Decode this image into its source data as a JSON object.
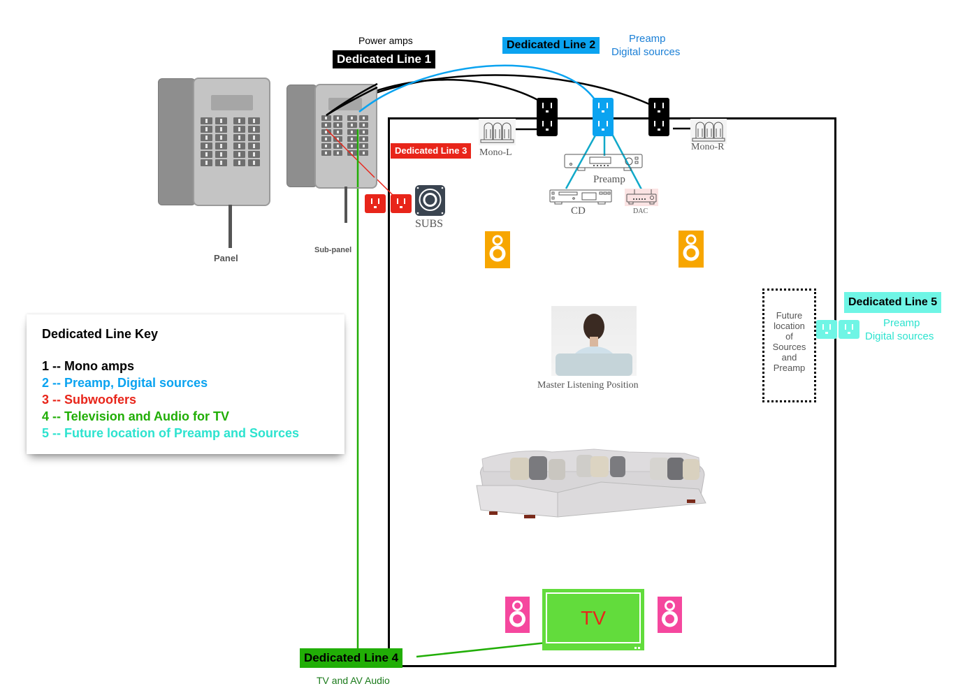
{
  "colors": {
    "line1": "#000000",
    "line2": "#0aa3f0",
    "line3": "#e8251a",
    "line4": "#21ae06",
    "line5": "#2de3cf",
    "line5_box": "#6ff5e5",
    "speaker_front": "#f7a600",
    "speaker_rear": "#f5479e",
    "tv": "#62dc3c"
  },
  "panels": {
    "main_label": "Panel",
    "sub_label": "Sub-panel"
  },
  "lines": {
    "line1": {
      "label": "Dedicated Line 1",
      "caption": "Power amps"
    },
    "line2": {
      "label": "Dedicated Line 2",
      "caption_1": "Preamp",
      "caption_2": "Digital sources"
    },
    "line3": {
      "label": "Dedicated Line 3"
    },
    "line4": {
      "label": "Dedicated Line 4",
      "caption": "TV and AV Audio"
    },
    "line5": {
      "label": "Dedicated Line 5",
      "caption_1": "Preamp",
      "caption_2": "Digital sources"
    }
  },
  "equipment": {
    "mono_left": "Mono-L",
    "mono_right": "Mono-R",
    "preamp": "Preamp",
    "cd": "CD",
    "dac": "DAC",
    "subs": "SUBS",
    "tv": "TV",
    "listening_position": "Master Listening Position"
  },
  "future_box": {
    "lines": [
      "Future",
      "location",
      "of",
      "Sources",
      "and",
      "Preamp"
    ]
  },
  "legend": {
    "title": "Dedicated Line Key",
    "items": [
      {
        "text": "1 -- Mono amps"
      },
      {
        "text": "2 -- Preamp, Digital sources"
      },
      {
        "text": "3 -- Subwoofers"
      },
      {
        "text": "4 -- Television and Audio for TV"
      },
      {
        "text": "5 -- Future location of Preamp and Sources"
      }
    ]
  }
}
